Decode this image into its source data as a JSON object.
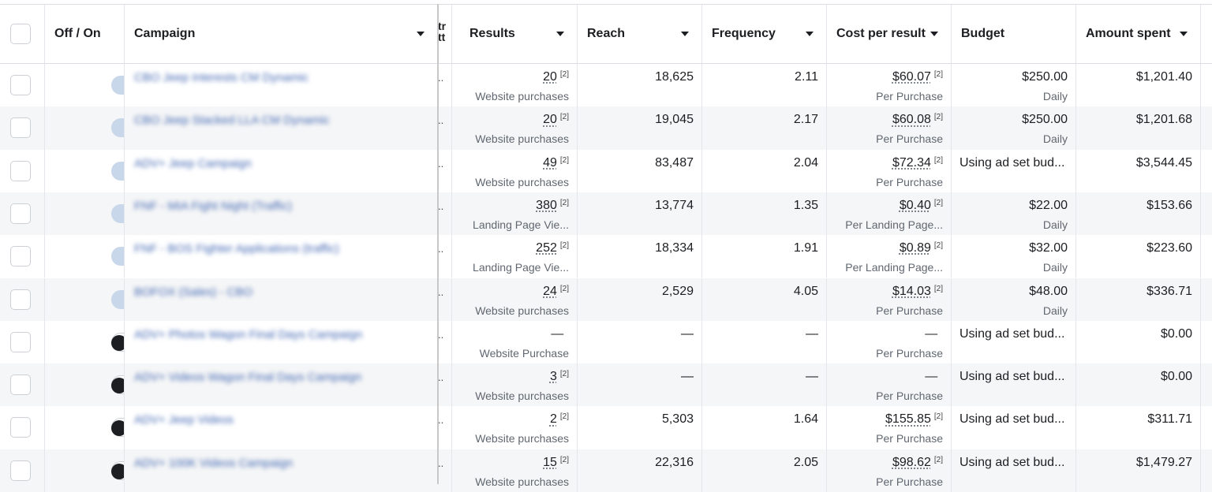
{
  "columns": {
    "off_on": "Off / On",
    "campaign": "Campaign",
    "strategy_fragment": "tr tt",
    "results": "Results",
    "reach": "Reach",
    "frequency": "Frequency",
    "cost_per_result": "Cost per result",
    "budget": "Budget",
    "amount_spent": "Amount spent"
  },
  "footnote": "[2]",
  "rows": [
    {
      "on": true,
      "campaign": "CBO Jeep Interests CM Dynamic",
      "dots": "..",
      "results": "20",
      "results_type": "Website purchases",
      "reach": "18,625",
      "frequency": "2.11",
      "cost": "$60.07",
      "cost_type": "Per Purchase",
      "budget": "$250.00",
      "budget_type": "Daily",
      "spent": "$1,201.40"
    },
    {
      "on": true,
      "campaign": "CBO Jeep Stacked LLA CM Dynamic",
      "dots": "..",
      "results": "20",
      "results_type": "Website purchases",
      "reach": "19,045",
      "frequency": "2.17",
      "cost": "$60.08",
      "cost_type": "Per Purchase",
      "budget": "$250.00",
      "budget_type": "Daily",
      "spent": "$1,201.68"
    },
    {
      "on": true,
      "campaign": "ADV+ Jeep Campaign",
      "dots": "..",
      "results": "49",
      "results_type": "Website purchases",
      "reach": "83,487",
      "frequency": "2.04",
      "cost": "$72.34",
      "cost_type": "Per Purchase",
      "budget": "Using ad set bud...",
      "budget_type": "",
      "spent": "$3,544.45"
    },
    {
      "on": true,
      "campaign": "FNF - MIA Fight Night (Traffic)",
      "dots": "..",
      "results": "380",
      "results_type": "Landing Page Vie...",
      "reach": "13,774",
      "frequency": "1.35",
      "cost": "$0.40",
      "cost_type": "Per Landing Page...",
      "budget": "$22.00",
      "budget_type": "Daily",
      "spent": "$153.66"
    },
    {
      "on": true,
      "campaign": "FNF - BOS Fighter Applications (traffic)",
      "dots": "..",
      "results": "252",
      "results_type": "Landing Page Vie...",
      "reach": "18,334",
      "frequency": "1.91",
      "cost": "$0.89",
      "cost_type": "Per Landing Page...",
      "budget": "$32.00",
      "budget_type": "Daily",
      "spent": "$223.60"
    },
    {
      "on": true,
      "campaign": "BOFOX (Sales) - CBO",
      "dots": "..",
      "results": "24",
      "results_type": "Website purchases",
      "reach": "2,529",
      "frequency": "4.05",
      "cost": "$14.03",
      "cost_type": "Per Purchase",
      "budget": "$48.00",
      "budget_type": "Daily",
      "spent": "$336.71"
    },
    {
      "on": false,
      "campaign": "ADV+ Photos Wagon Final Days Campaign",
      "dots": "..",
      "results": "—",
      "results_type": "Website Purchase",
      "reach": "—",
      "frequency": "—",
      "cost": "—",
      "cost_type": "Per Purchase",
      "budget": "Using ad set bud...",
      "budget_type": "",
      "spent": "$0.00"
    },
    {
      "on": false,
      "campaign": "ADV+ Videos Wagon Final Days Campaign",
      "dots": "..",
      "results": "3",
      "results_type": "Website purchases",
      "reach": "—",
      "frequency": "—",
      "cost": "—",
      "cost_type": "Per Purchase",
      "budget": "Using ad set bud...",
      "budget_type": "",
      "spent": "$0.00"
    },
    {
      "on": false,
      "campaign": "ADV+ Jeep Videos",
      "dots": "..",
      "results": "2",
      "results_type": "Website purchases",
      "reach": "5,303",
      "frequency": "1.64",
      "cost": "$155.85",
      "cost_type": "Per Purchase",
      "budget": "Using ad set bud...",
      "budget_type": "",
      "spent": "$311.71"
    },
    {
      "on": false,
      "campaign": "ADV+ 100K Videos Campaign",
      "dots": "..",
      "results": "15",
      "results_type": "Website purchases",
      "reach": "22,316",
      "frequency": "2.05",
      "cost": "$98.62",
      "cost_type": "Per Purchase",
      "budget": "Using ad set bud...",
      "budget_type": "",
      "spent": "$1,479.27"
    }
  ],
  "colors": {
    "toggle_on": "#1877f2",
    "toggle_off_knob": "#1c1e21",
    "row_alt": "#f5f6f7",
    "campaign_link": "#4267b2"
  }
}
